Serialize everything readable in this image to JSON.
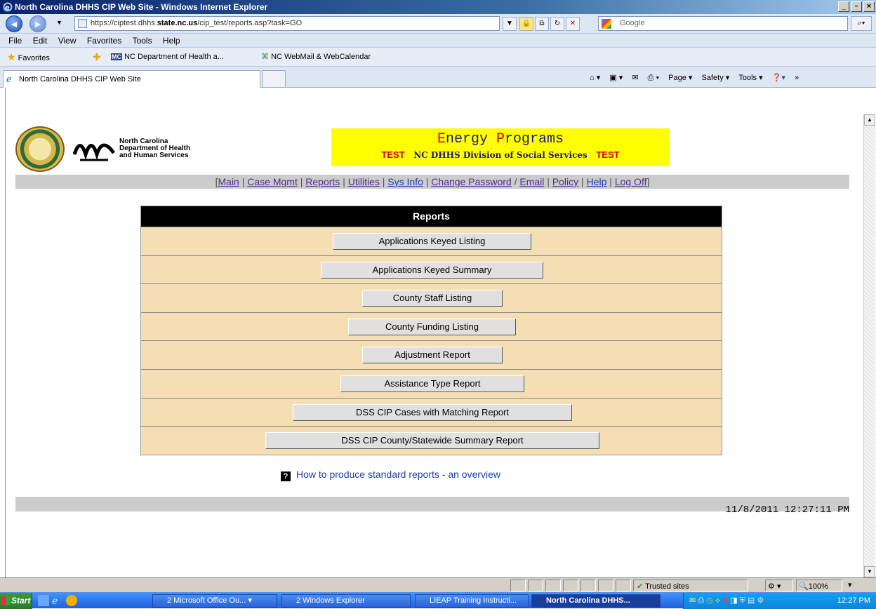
{
  "window": {
    "title": "North Carolina DHHS CIP Web Site - Windows Internet Explorer"
  },
  "address": {
    "url_prefix": "https://ciptest.dhhs.",
    "url_host": "state.nc.us",
    "url_path": "/cip_test/reports.asp?task=GO",
    "search_placeholder": "Google"
  },
  "menu": [
    "File",
    "Edit",
    "View",
    "Favorites",
    "Tools",
    "Help"
  ],
  "favorites": {
    "label": "Favorites",
    "items": [
      "NC Department of Health a...",
      "NC WebMail & WebCalendar"
    ]
  },
  "tab": {
    "label": "North Carolina DHHS CIP Web Site"
  },
  "commandbar": [
    "Page ▾",
    "Safety ▾",
    "Tools ▾"
  ],
  "header": {
    "org_line1": "North Carolina",
    "org_line2": "Department of Health",
    "org_line3": "and Human Services",
    "banner_title_E": "E",
    "banner_title_1": "nergy ",
    "banner_title_P": "P",
    "banner_title_2": "rograms",
    "test_left": "TEST",
    "division": "NC DHHS Division of Social Services",
    "test_right": "TEST"
  },
  "nav": {
    "open": "[",
    "close": "]",
    "links": [
      "Main",
      "Case Mgmt",
      "Reports",
      "Utilities",
      "Sys Info",
      "Change Password",
      "Email",
      "Policy",
      "Help",
      "Log Off"
    ]
  },
  "reports": {
    "heading": "Reports",
    "buttons": [
      "Applications Keyed Listing",
      "Applications Keyed Summary",
      "County Staff Listing",
      "County Funding Listing",
      "Adjustment Report",
      "Assistance Type Report",
      "DSS CIP Cases with Matching Report",
      "DSS CIP County/Statewide Summary Report"
    ]
  },
  "help": {
    "icon": "?",
    "text": "How to produce standard reports - an overview"
  },
  "timestamp": "11/8/2011 12:27:11 PM",
  "status": {
    "zone": "Trusted sites",
    "zoom": "100%"
  },
  "taskbar": {
    "start": "Start",
    "items": [
      "2 Microsoft Office Ou... ▾",
      "2 Windows Explorer",
      "LIEAP Training Instructi...",
      "North Carolina DHHS..."
    ],
    "clock": "12:27 PM"
  }
}
